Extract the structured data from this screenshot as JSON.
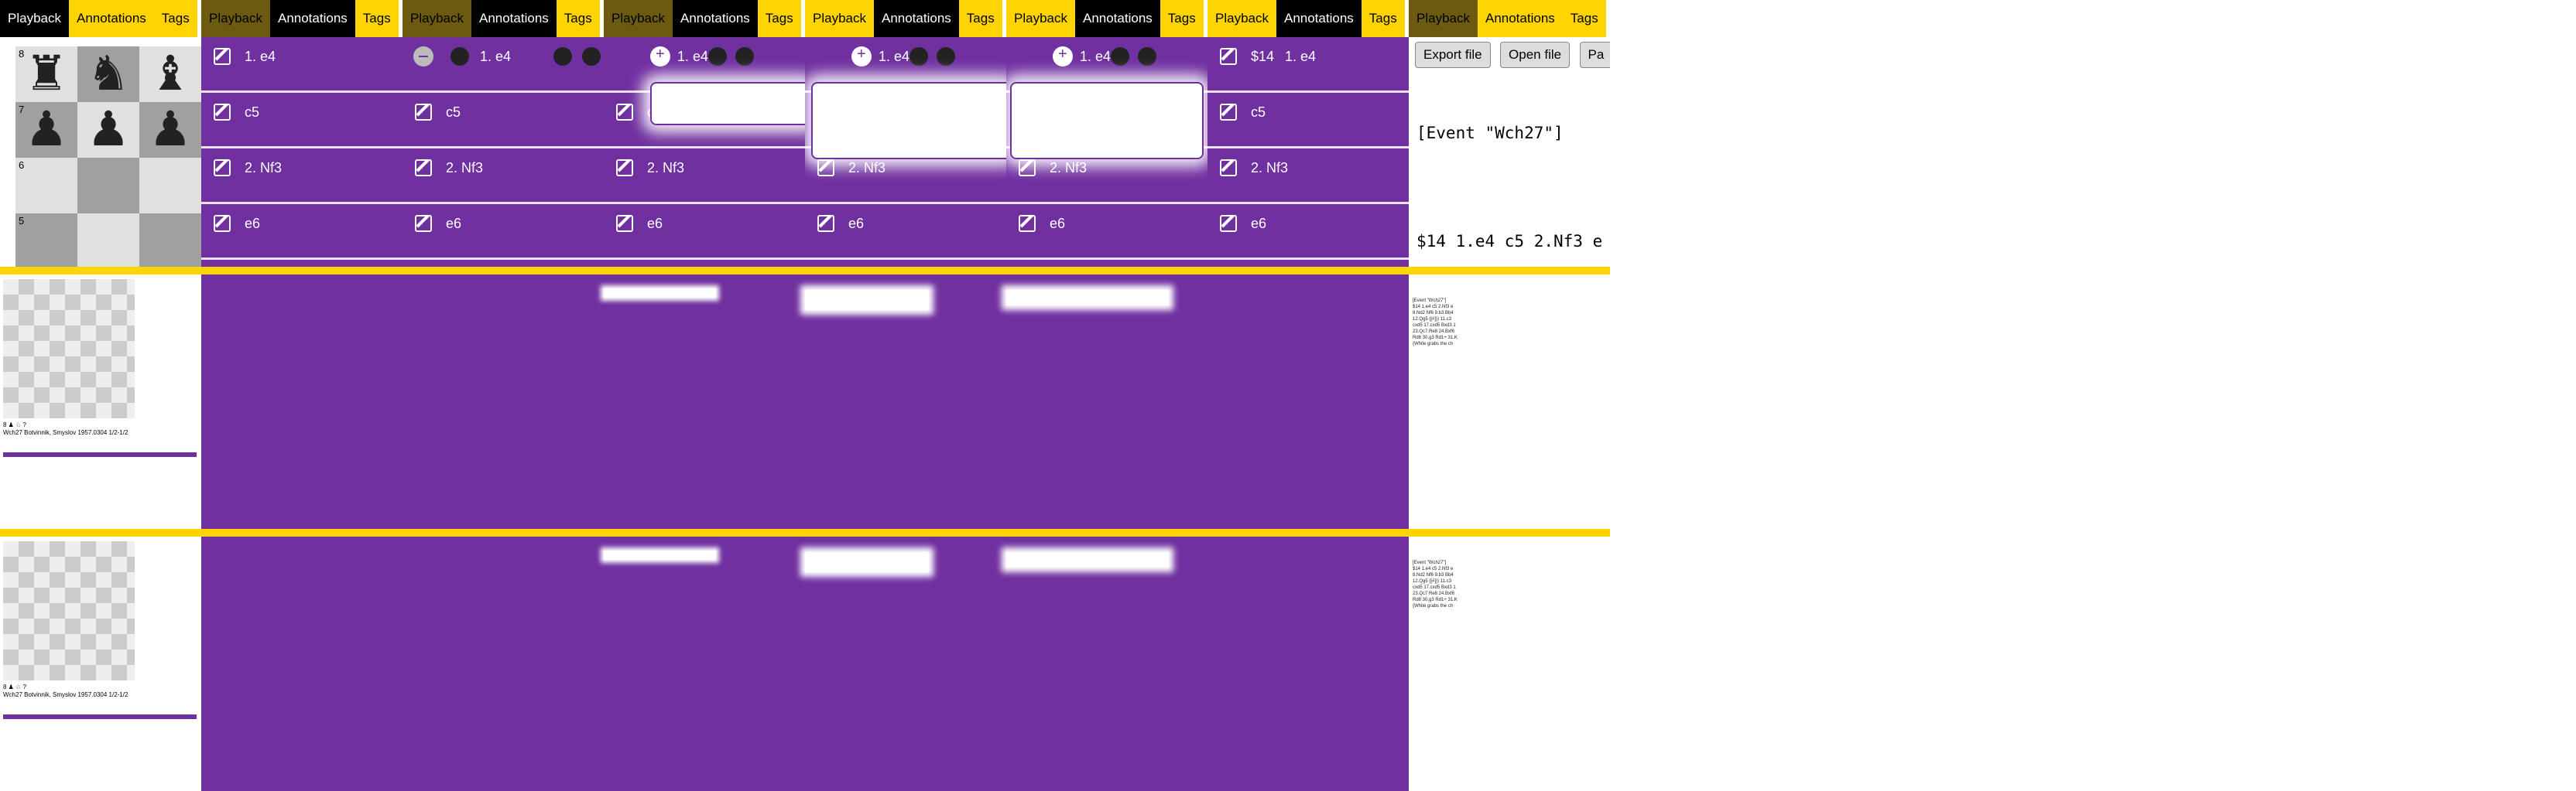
{
  "tabs": {
    "playback": "Playback",
    "annotations": "Annotations",
    "tags": "Tags"
  },
  "moves": [
    {
      "label": "1.  e4"
    },
    {
      "label": "c5"
    },
    {
      "label": "2.  Nf3"
    },
    {
      "label": "e6"
    }
  ],
  "nag_move": {
    "nag": "$14",
    "label": "1.  e4"
  },
  "ranks": [
    "8",
    "7",
    "6",
    "5"
  ],
  "files_ranks_pieces": [
    "♜",
    "♞",
    "♝",
    "♟"
  ],
  "buttons": {
    "export": "Export file",
    "open": "Open file",
    "paste": "Pa"
  },
  "pgn_lines": [
    "[Event \"Wch27\"]",
    "",
    "$14 1.e4 c5 2.Nf3 e",
    "8.Nd2 Nf6 9.b3 Bb4",
    "12.Qg5 {[#]}) 11.c3",
    "cxd5 17.cxd5 Bxd3 1",
    "23.Qc7 Re8 24.Bxf6",
    "Rd8 30.g3 Rd1+ 31.K",
    "{White grabs the ch"
  ],
  "mini_status": {
    "move": "8 ♟ ♘ ?",
    "game": "Wch27 Botvinnik, Smyslov 1957.0304 1/2-1/2"
  },
  "colors": {
    "purple": "#7030a0",
    "yellow": "#ffd400",
    "black": "#000000",
    "olive": "#6b5a10"
  }
}
